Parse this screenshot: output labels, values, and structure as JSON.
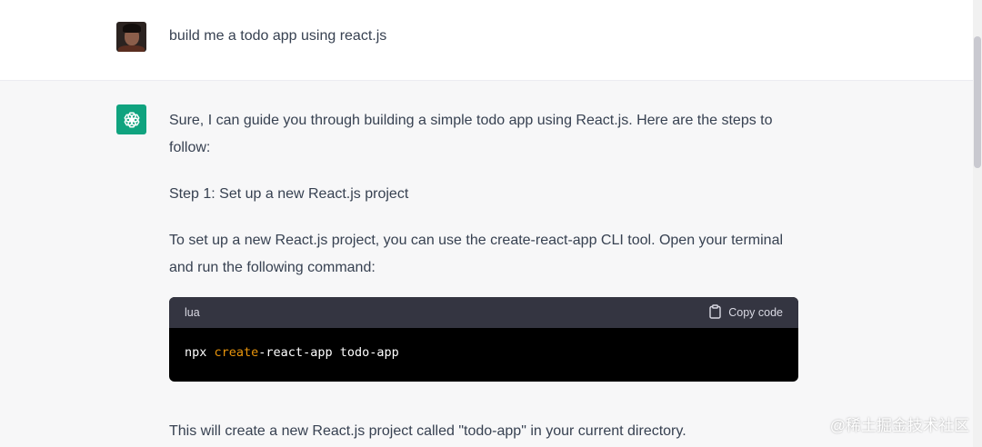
{
  "user_message": {
    "text": "build me a todo app using react.js"
  },
  "assistant_message": {
    "intro": "Sure, I can guide you through building a simple todo app using React.js. Here are the steps to follow:",
    "step1": "Step 1: Set up a new React.js project",
    "setup_text": "To set up a new React.js project, you can use the create-react-app CLI tool. Open your terminal and run the following command:",
    "code_block": {
      "language": "lua",
      "copy_label": "Copy code",
      "code_prefix": "npx ",
      "code_highlight": "create",
      "code_suffix": "-react-app todo-app"
    },
    "result_text": "This will create a new React.js project called \"todo-app\" in your current directory."
  },
  "watermark": "@稀土掘金技术社区",
  "colors": {
    "assistant_avatar_bg": "#10a37f",
    "code_header_bg": "#343541",
    "code_bg": "#000000",
    "keyword_highlight": "#e9950c",
    "assistant_row_bg": "#f7f7f8",
    "user_row_bg": "#ffffff"
  },
  "icons": {
    "assistant_avatar": "openai-logo-icon",
    "copy": "clipboard-icon"
  }
}
